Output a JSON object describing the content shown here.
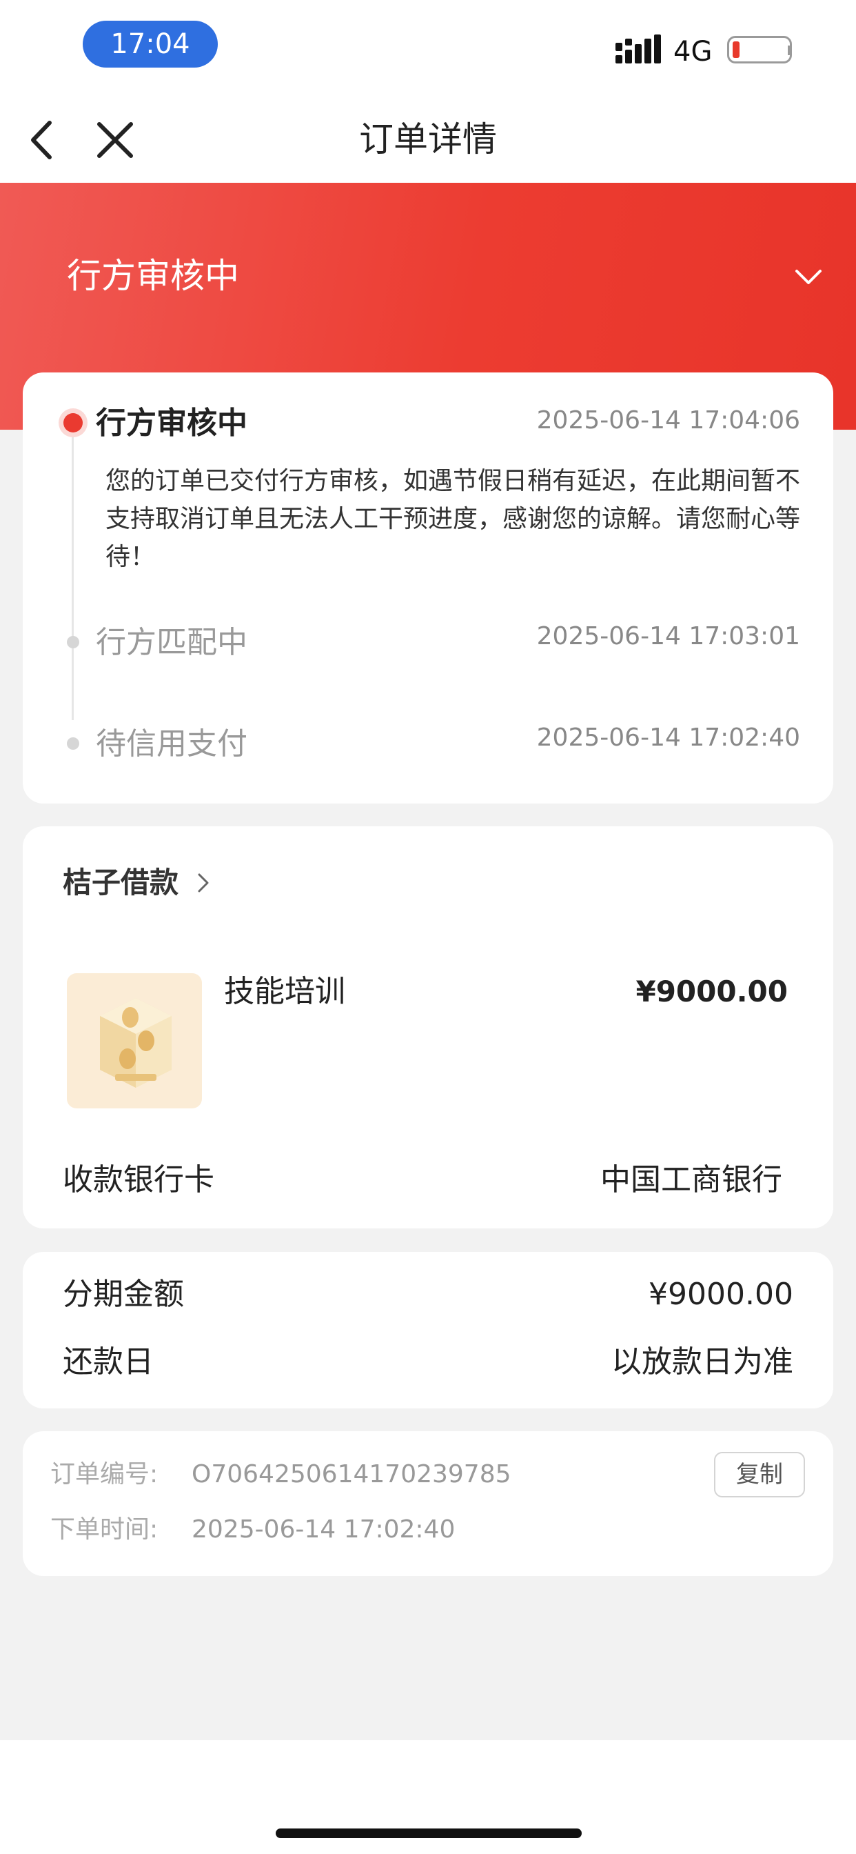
{
  "status_bar": {
    "time": "17:04",
    "network": "4G",
    "battery_level": 0.1,
    "icons": [
      "signal-icon",
      "battery-icon"
    ]
  },
  "nav": {
    "title": "订单详情",
    "icons": [
      "back-arrow-icon",
      "close-icon"
    ]
  },
  "banner": {
    "status": "行方审核中",
    "icon": "chevron-down-icon"
  },
  "timeline": [
    {
      "title": "行方审核中",
      "time": "2025-06-14 17:04:06",
      "active": true,
      "description": "您的订单已交付行方审核，如遇节假日稍有延迟，在此期间暂不支持取消订单且无法人工干预进度，感谢您的谅解。请您耐心等待！"
    },
    {
      "title": "行方匹配中",
      "time": "2025-06-14 17:03:01",
      "active": false
    },
    {
      "title": "待信用支付",
      "time": "2025-06-14 17:02:40",
      "active": false
    }
  ],
  "product": {
    "merchant": "桔子借款",
    "name": "技能培训",
    "price": "¥9000.00",
    "bank_label": "收款银行卡",
    "bank_value": "中国工商银行"
  },
  "installment": {
    "amount_label": "分期金额",
    "amount_value": "¥9000.00",
    "repay_label": "还款日",
    "repay_value": "以放款日为准"
  },
  "order": {
    "number_label": "订单编号:",
    "number_value": "O7064250614170239785",
    "copy_label": "复制",
    "time_label": "下单时间:",
    "time_value": "2025-06-14 17:02:40"
  },
  "colors": {
    "accent": "#e8392b",
    "time_pill": "#2f6fe0",
    "background": "#f2f2f2"
  }
}
